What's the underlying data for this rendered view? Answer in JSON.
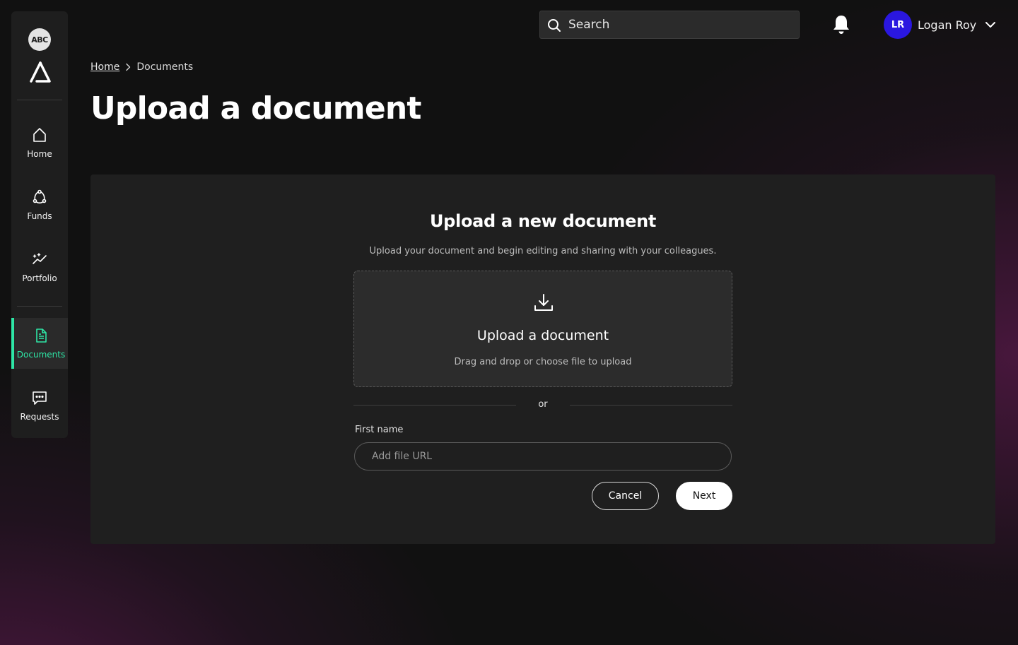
{
  "sidebar": {
    "org_badge": "ABC",
    "items": [
      {
        "label": "Home",
        "icon": "home-icon"
      },
      {
        "label": "Funds",
        "icon": "funds-icon"
      },
      {
        "label": "Portfolio",
        "icon": "portfolio-icon"
      },
      {
        "label": "Documents",
        "icon": "document-icon",
        "active": true
      },
      {
        "label": "Requests",
        "icon": "chat-icon"
      }
    ],
    "accent_color": "#2ee6a6"
  },
  "header": {
    "search": {
      "placeholder": "Search",
      "icon": "search-icon"
    },
    "notifications_icon": "bell-icon",
    "user": {
      "initials": "LR",
      "name": "Logan Roy",
      "avatar_color": "#2a17e0"
    }
  },
  "breadcrumb": {
    "home": "Home",
    "current": "Documents"
  },
  "page_title": "Upload a document",
  "upload": {
    "title": "Upload a new document",
    "subtitle": "Upload your document and begin editing and sharing with your colleagues.",
    "dropzone": {
      "icon": "download-icon",
      "title": "Upload a document",
      "hint": "Drag and drop or choose file to upload"
    },
    "divider_text": "or",
    "url_field": {
      "label": "First name",
      "placeholder": "Add file URL",
      "value": ""
    },
    "cancel_label": "Cancel",
    "next_label": "Next"
  }
}
